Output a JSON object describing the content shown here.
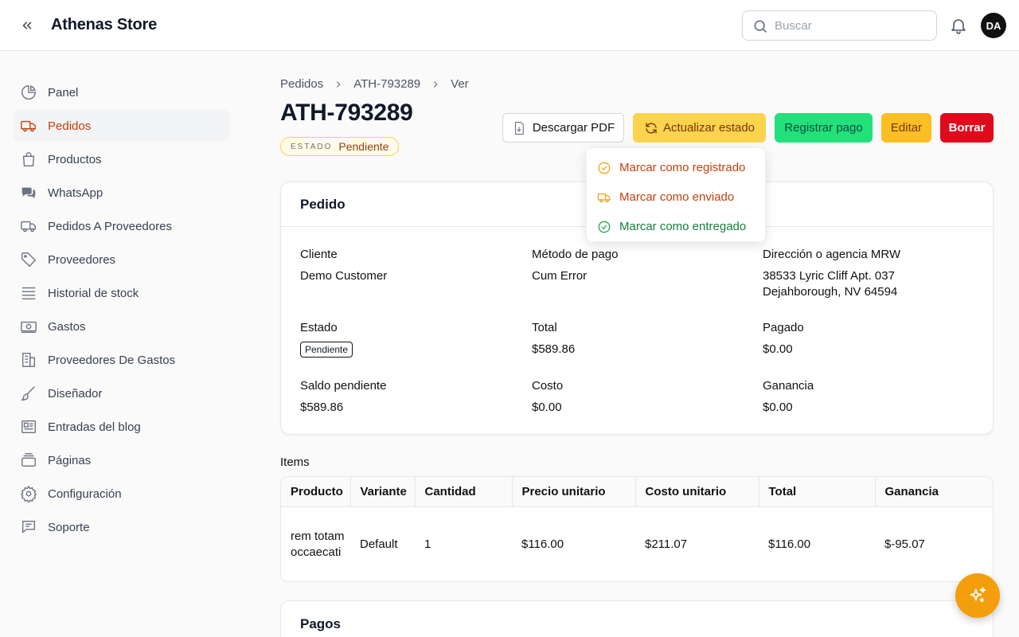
{
  "header": {
    "store_name": "Athenas Store",
    "search_placeholder": "Buscar",
    "avatar_initials": "DA"
  },
  "sidebar": {
    "items": [
      {
        "label": "Panel",
        "icon": "pie-chart-icon"
      },
      {
        "label": "Pedidos",
        "icon": "truck-icon",
        "active": true
      },
      {
        "label": "Productos",
        "icon": "shopping-bag-icon"
      },
      {
        "label": "WhatsApp",
        "icon": "chat-bubbles-icon"
      },
      {
        "label": "Pedidos A Proveedores",
        "icon": "truck-icon"
      },
      {
        "label": "Proveedores",
        "icon": "tag-icon"
      },
      {
        "label": "Historial de stock",
        "icon": "stack-icon"
      },
      {
        "label": "Gastos",
        "icon": "banknote-icon"
      },
      {
        "label": "Proveedores De Gastos",
        "icon": "building-icon"
      },
      {
        "label": "Diseñador",
        "icon": "paintbrush-icon"
      },
      {
        "label": "Entradas del blog",
        "icon": "newspaper-icon"
      },
      {
        "label": "Páginas",
        "icon": "pages-icon"
      },
      {
        "label": "Configuración",
        "icon": "gear-icon"
      },
      {
        "label": "Soporte",
        "icon": "support-chat-icon"
      }
    ]
  },
  "breadcrumb": [
    "Pedidos",
    "ATH-793289",
    "Ver"
  ],
  "page": {
    "title": "ATH-793289",
    "status_key": "ESTADO",
    "status_value": "Pendiente"
  },
  "actions": {
    "download_pdf": "Descargar PDF",
    "update_state": "Actualizar estado",
    "register_payment": "Registrar pago",
    "edit": "Editar",
    "delete": "Borrar"
  },
  "dropdown": {
    "items": [
      "Marcar como registrado",
      "Marcar como enviado",
      "Marcar como entregado"
    ]
  },
  "order": {
    "heading": "Pedido",
    "client_label": "Cliente",
    "client_value": "Demo Customer",
    "payment_label": "Método de pago",
    "payment_value": "Cum Error",
    "address_label": "Dirección o agencia MRW",
    "address_line1": "38533 Lyric Cliff Apt. 037",
    "address_line2": "Dejahborough, NV 64594",
    "status_label": "Estado",
    "status_value": "Pendiente",
    "total_label": "Total",
    "total_value": "$589.86",
    "paid_label": "Pagado",
    "paid_value": "$0.00",
    "balance_label": "Saldo pendiente",
    "balance_value": "$589.86",
    "cost_label": "Costo",
    "cost_value": "$0.00",
    "profit_label": "Ganancia",
    "profit_value": "$0.00"
  },
  "items": {
    "label": "Items",
    "columns": [
      "Producto",
      "Variante",
      "Cantidad",
      "Precio unitario",
      "Costo unitario",
      "Total",
      "Ganancia"
    ],
    "rows": [
      {
        "product": "rem totam occaecati",
        "variant": "Default",
        "quantity": "1",
        "unit_price": "$116.00",
        "unit_cost": "$211.07",
        "total": "$116.00",
        "profit": "$-95.07"
      }
    ]
  },
  "payments": {
    "heading": "Pagos"
  },
  "colors": {
    "accent": "#c2410c",
    "warning": "#fcd34d",
    "success": "#22e07a",
    "danger": "#e00a1c"
  }
}
